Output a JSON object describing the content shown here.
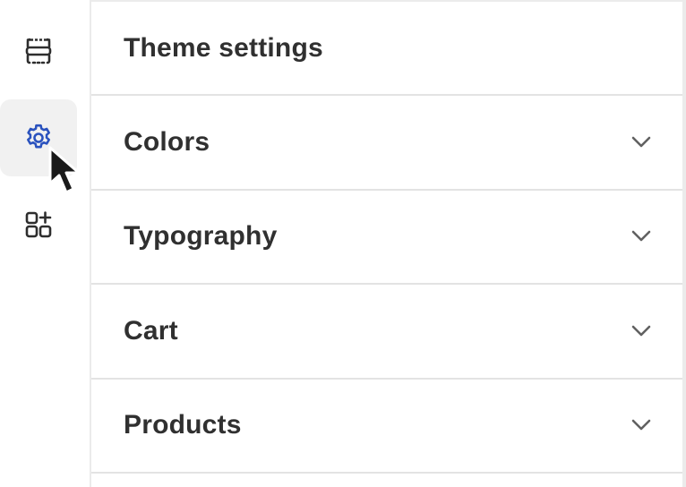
{
  "sidebar": {
    "items": [
      {
        "name": "sections",
        "icon": "sections-icon"
      },
      {
        "name": "theme-settings",
        "icon": "gear-icon",
        "active": true
      },
      {
        "name": "apps",
        "icon": "app-blocks-icon"
      }
    ],
    "active_color": "#2a52be"
  },
  "panel": {
    "title": "Theme settings",
    "sections": [
      {
        "label": "Colors",
        "icon": "chevron-down-icon"
      },
      {
        "label": "Typography",
        "icon": "chevron-down-icon"
      },
      {
        "label": "Cart",
        "icon": "chevron-down-icon"
      },
      {
        "label": "Products",
        "icon": "chevron-down-icon"
      }
    ]
  }
}
